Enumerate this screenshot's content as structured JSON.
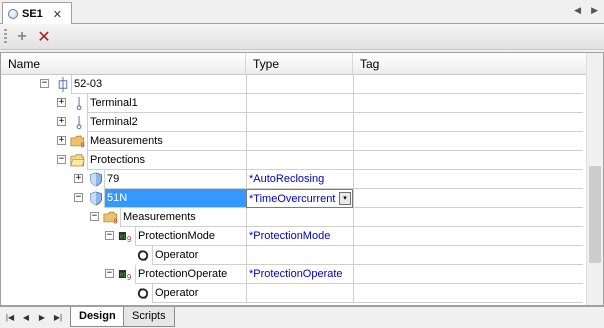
{
  "document_tab": {
    "title": "SE1",
    "close": "✕"
  },
  "nav": {
    "left": "◀",
    "right": "▶"
  },
  "toolbar": {
    "add": "+",
    "delete": "✕"
  },
  "columns": {
    "name": "Name",
    "type": "Type",
    "tag": "Tag"
  },
  "rows": [
    {
      "label": "52-03",
      "type": "",
      "expander": "−",
      "icon": "switch-icon"
    },
    {
      "label": "Terminal1",
      "type": "",
      "expander": "+",
      "icon": "terminal-icon"
    },
    {
      "label": "Terminal2",
      "type": "",
      "expander": "+",
      "icon": "terminal-icon"
    },
    {
      "label": "Measurements",
      "type": "",
      "expander": "+",
      "icon": "folder-measurements-icon"
    },
    {
      "label": "Protections",
      "type": "",
      "expander": "−",
      "icon": "folder-open-icon"
    },
    {
      "label": "79",
      "type": "*AutoReclosing",
      "expander": "+",
      "icon": "shield-icon"
    },
    {
      "label": "51N",
      "type": "*TimeOvercurrent",
      "expander": "−",
      "icon": "shield-icon"
    },
    {
      "label": "Measurements",
      "type": "",
      "expander": "−",
      "icon": "folder-measurements-icon"
    },
    {
      "label": "ProtectionMode",
      "type": "*ProtectionMode",
      "expander": "−",
      "icon": "data-object-icon"
    },
    {
      "label": "Operator",
      "type": "",
      "expander": "",
      "icon": "operator-icon"
    },
    {
      "label": "ProtectionOperate",
      "type": "*ProtectionOperate",
      "expander": "−",
      "icon": "data-object-icon"
    },
    {
      "label": "Operator",
      "type": "",
      "expander": "",
      "icon": "operator-icon"
    }
  ],
  "combo_arrow": "▾",
  "sheet_tabs": {
    "design": "Design",
    "scripts": "Scripts"
  },
  "sheet_nav": {
    "first": "|◀",
    "prev": "◀",
    "next": "▶",
    "last": "▶|"
  },
  "colors": {
    "selection": "#3399ff",
    "type_text": "#0000c8"
  }
}
